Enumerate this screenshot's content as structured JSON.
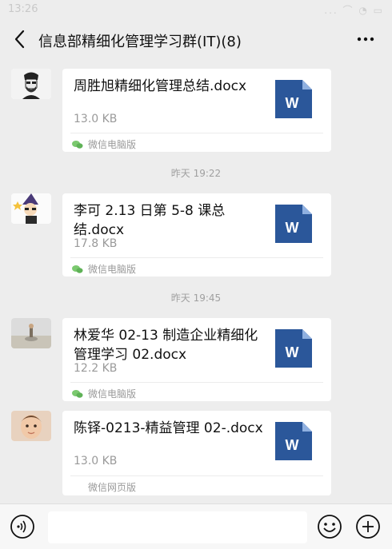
{
  "status_bar": {
    "time": "13:26",
    "icons": "... ⌒ ◔ ▭"
  },
  "nav": {
    "title": "信息部精细化管理学习群(IT)(8)"
  },
  "messages": [
    {
      "filename": "周胜旭精细化管理总结.docx",
      "size": "13.0 KB",
      "source": "微信电脑版",
      "source_icon": "pc-wechat-icon"
    },
    {
      "timestamp": "昨天 19:22"
    },
    {
      "filename": "李可 2.13 日第 5-8 课总结.docx",
      "size": "17.8 KB",
      "source": "微信电脑版",
      "source_icon": "pc-wechat-icon"
    },
    {
      "timestamp": "昨天 19:45"
    },
    {
      "filename": "林爱华 02-13 制造企业精细化管理学习 02.docx",
      "size": "12.2 KB",
      "source": "微信电脑版",
      "source_icon": "pc-wechat-icon"
    },
    {
      "filename": "陈铎-0213-精益管理 02-.docx",
      "size": "13.0 KB",
      "source": "微信网页版"
    }
  ],
  "file_icon": {
    "letter": "W",
    "color": "#2b579a"
  },
  "input_bar": {
    "placeholder": ""
  }
}
